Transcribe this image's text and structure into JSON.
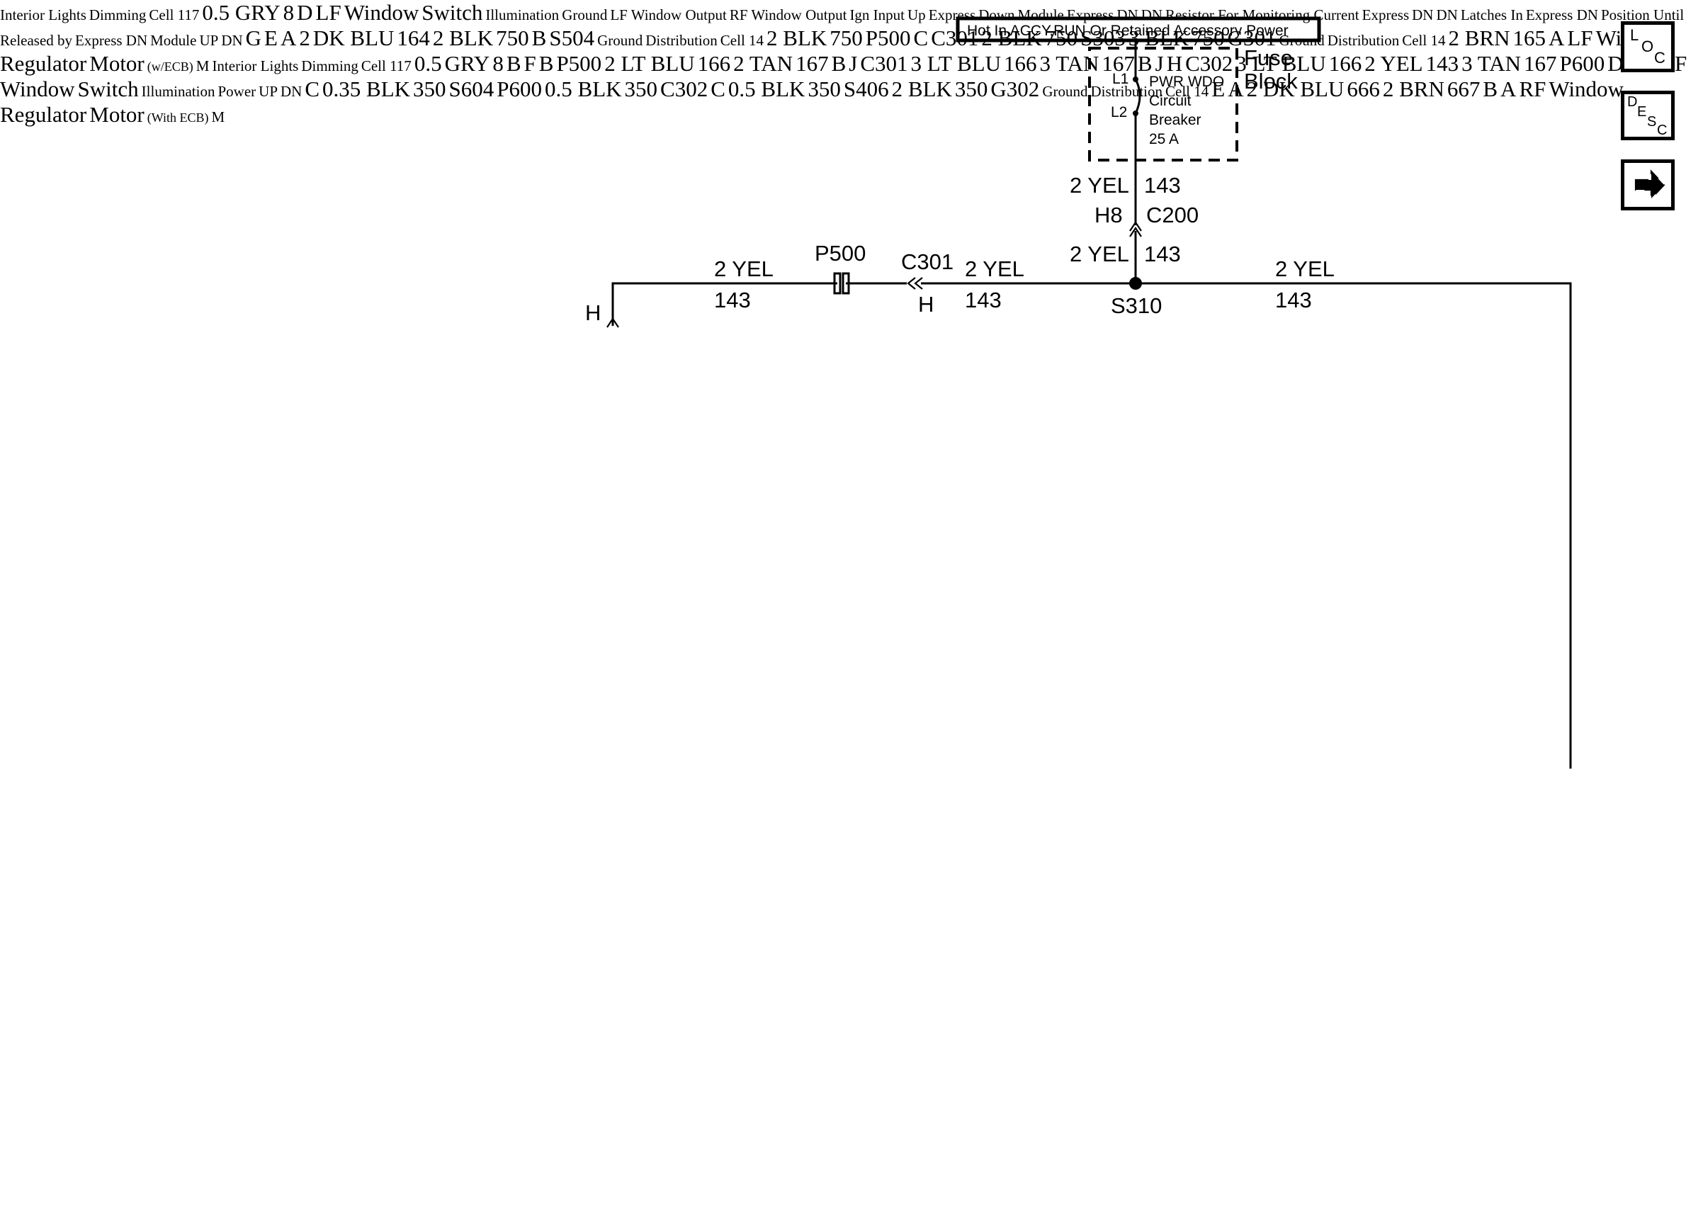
{
  "title_banner": "Hot In ACCY,RUN Or Retained Accessory Power",
  "nav": {
    "loc": [
      "L",
      "O",
      "C"
    ],
    "desc": [
      "D",
      "E",
      "S",
      "C"
    ],
    "next_icon": "right-arrow-icon"
  },
  "fuse_block": {
    "name_line1": "Fuse",
    "name_line2": "Block",
    "l1": "L1",
    "l2": "L2",
    "desc": [
      "PWR WDO",
      "Circuit",
      "Breaker",
      "25 A"
    ]
  },
  "components": {
    "lf_switch": [
      "LF",
      "Window",
      "Switch"
    ],
    "rf_switch": [
      "RF",
      "Window",
      "Switch"
    ],
    "lf_motor": [
      "LF",
      "Window",
      "Regulator",
      "Motor"
    ],
    "lf_motor_note": "(w/ECB)",
    "rf_motor": [
      "RF",
      "Window",
      "Regulator",
      "Motor"
    ],
    "rf_motor_note": "(With ECB)",
    "express_down_module": [
      "Express",
      "Down",
      "Module"
    ],
    "motor_symbol": "M"
  },
  "lf_switch_internal": {
    "illumination": "Illumination",
    "ign_input": "Ign Input",
    "up": "Up",
    "express_dn_1": [
      "Express",
      "DN"
    ],
    "dn_1": "DN",
    "express_dn_2": [
      "Express",
      "DN"
    ],
    "dn_2": "DN",
    "latch_note": [
      "Latches In",
      "Express DN",
      "Position Until",
      "Released by",
      "Express DN",
      "Module"
    ],
    "resistor_note": "Resistor For Monitoring Current",
    "ground": "Ground",
    "lf_output": "LF Window Output",
    "rf_output": "RF Window Output",
    "rf_up": "UP",
    "rf_dn": "DN"
  },
  "rf_switch_internal": {
    "illumination": "Illumination",
    "power": "Power",
    "up": "UP",
    "dn": "DN"
  },
  "ref_boxes": {
    "dimming_1": [
      "Interior Lights",
      "Dimming",
      "Cell 117"
    ],
    "dimming_2": [
      "Interior Lights",
      "Dimming",
      "Cell 117"
    ],
    "ground_1": [
      "Ground",
      "Distribution",
      "Cell 14"
    ],
    "ground_2": [
      "Ground",
      "Distribution",
      "Cell 14"
    ],
    "ground_3": [
      "Ground",
      "Distribution",
      "Cell 14"
    ]
  },
  "wire_labels": {
    "fuse_out_wire": "2 YEL",
    "fuse_out_circuit": "143",
    "c200_pin": "H8",
    "c200": "C200",
    "s310_up_wire": "2 YEL",
    "s310_up_circuit": "143",
    "top_left_wire": "2 YEL",
    "top_left_circuit": "143",
    "p500_top": "P500",
    "c301_top": "C301",
    "c301_top_pin": "H",
    "top_mid_wire": "2 YEL",
    "top_mid_circuit": "143",
    "s310": "S310",
    "top_right_wire": "2 YEL",
    "top_right_circuit": "143",
    "lf_h_pin": "H",
    "lf_d_pin": "D",
    "gry_wire": "0.5 GRY",
    "gry_circuit": "8",
    "g_pin": "G",
    "e_pin": "E",
    "a_pin_top": "A",
    "dkblu_wire_1": "2",
    "dkblu_wire_2": "DK BLU",
    "dkblu_circuit": "164",
    "blk_wire_1": "2 BLK",
    "blk_circuit_1": "750",
    "b_pin_motor": "B",
    "a_pin_motor": "A",
    "brn_wire": "2 BRN",
    "brn_circuit": "165",
    "s504": "S504",
    "blk_wire_2": "2 BLK",
    "blk_circuit_2": "750",
    "p500_left": "P500",
    "c301_left_pin": "C",
    "c301_left": "C301",
    "blk_wire_3": "2 BLK",
    "blk_circuit_3": "750",
    "s303": "S303",
    "blk3_wire": "3 BLK",
    "blk3_circuit": "750",
    "g301": "G301",
    "f_pin_lf": "F",
    "b_pin_lf": "B",
    "p500_right": "P500",
    "ltblu_wire_1": "2 LT BLU",
    "ltblu_circuit_1": "166",
    "tan_wire_1": "2 TAN",
    "tan_circuit_1": "167",
    "b_c301": "B",
    "j_c301": "J",
    "c301_right": "C301",
    "ltblu_wire_2": "3 LT BLU",
    "ltblu_circuit_2": "166",
    "tan_wire_2": "3 TAN",
    "tan_circuit_2": "167",
    "b_c302": "B",
    "j_c302": "J",
    "h_c302": "H",
    "c302_right": "C302",
    "ltblu_wire_3": "3 LT BLU",
    "ltblu_circuit_3": "166",
    "yel_wire_3": "2 YEL",
    "yel_circuit_3": "143",
    "tan_wire_3": "3 TAN",
    "tan_circuit_3": "167",
    "p600_right": "P600",
    "d_pin_rf": "D",
    "f_pin_rf": "F",
    "h_pin_rf": "H",
    "gry2_wire_1": "0.5",
    "gry2_wire_2": "GRY",
    "gry2_circuit": "8",
    "b_pin_rf_illum": "B",
    "c_pin_rf": "C",
    "blk035_wire": "0.35 BLK",
    "blk035_circuit": "350",
    "s604": "S604",
    "p600_mid": "P600",
    "blk05_wire_l": "0.5 BLK",
    "blk05_circuit_l": "350",
    "c302_mid": "C302",
    "c302_mid_pin": "C",
    "blk05_wire_r": "0.5 BLK",
    "blk05_circuit_r": "350",
    "s406": "S406",
    "blk2_g302_wire": "2 BLK",
    "blk2_g302_circuit": "350",
    "g302": "G302",
    "e_pin_rf": "E",
    "a_pin_rf": "A",
    "dkblu_rf_wire": "2 DK BLU",
    "dkblu_rf_circuit": "666",
    "brn_rf_wire": "2 BRN",
    "brn_rf_circuit": "667",
    "b_pin_rf_motor": "B",
    "a_pin_rf_motor": "A"
  }
}
